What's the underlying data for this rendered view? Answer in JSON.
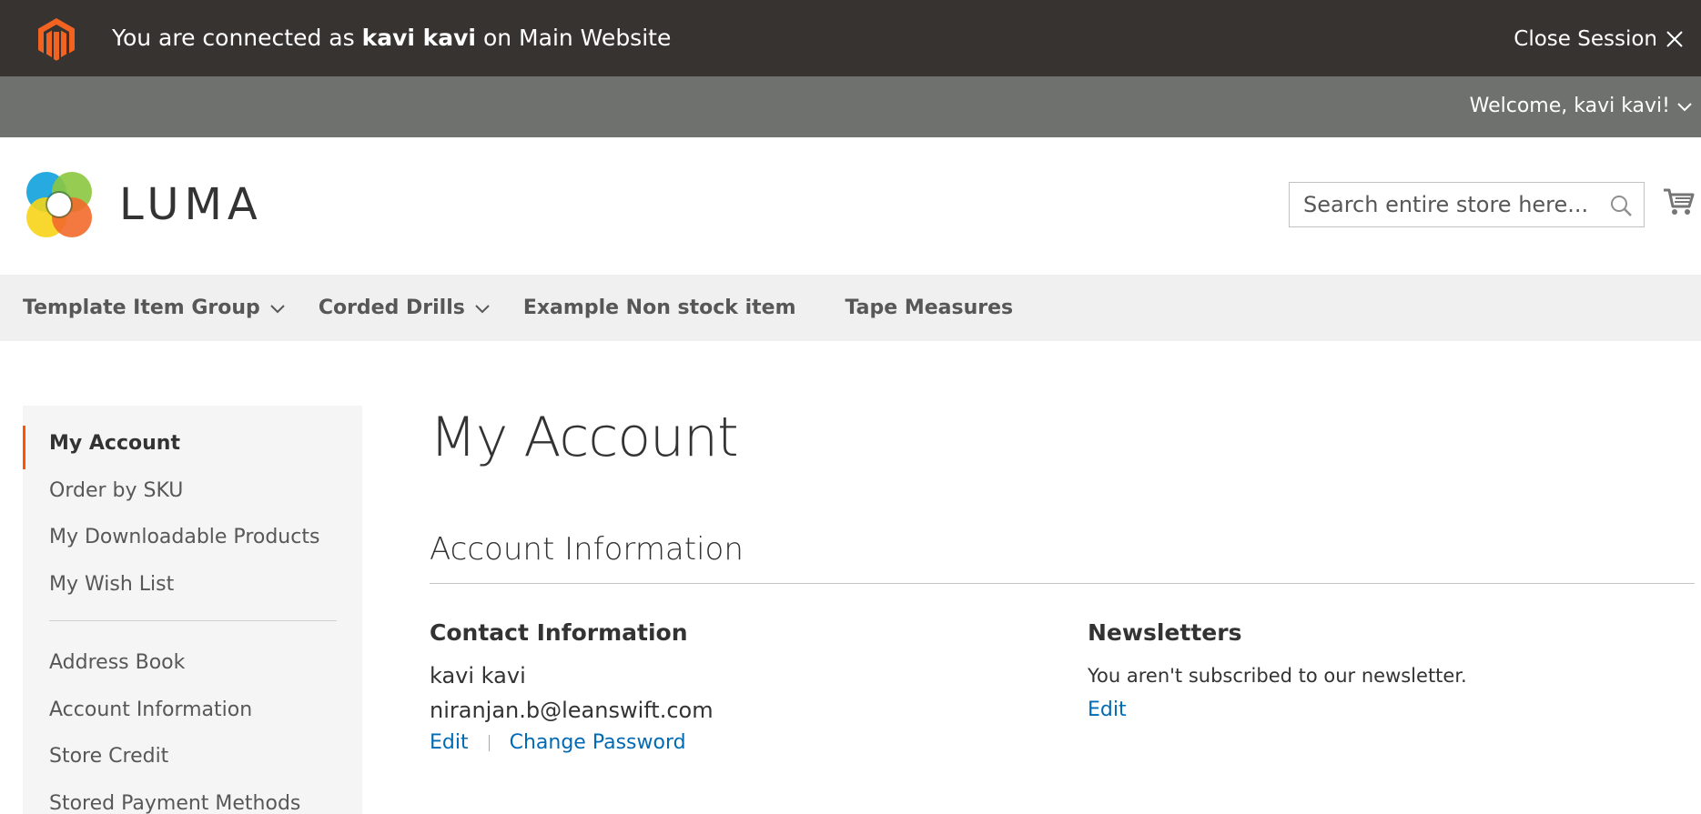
{
  "session_bar": {
    "prefix": "You are connected as",
    "user": "kavi kavi",
    "suffix": "on Main Website",
    "close_label": "Close Session"
  },
  "welcome_bar": {
    "welcome_text": "Welcome, kavi kavi!"
  },
  "header": {
    "logo_text": "LUMA",
    "search_placeholder": "Search entire store here...",
    "search_value": ""
  },
  "nav": {
    "items": [
      {
        "label": "Template Item Group",
        "has_submenu": true
      },
      {
        "label": "Corded Drills",
        "has_submenu": true
      },
      {
        "label": "Example Non stock item",
        "has_submenu": false
      },
      {
        "label": "Tape Measures",
        "has_submenu": false
      }
    ]
  },
  "sidebar": {
    "group1": [
      {
        "label": "My Account",
        "active": true
      },
      {
        "label": "Order by SKU",
        "active": false
      },
      {
        "label": "My Downloadable Products",
        "active": false
      },
      {
        "label": "My Wish List",
        "active": false
      }
    ],
    "group2": [
      {
        "label": "Address Book",
        "active": false
      },
      {
        "label": "Account Information",
        "active": false
      },
      {
        "label": "Store Credit",
        "active": false
      },
      {
        "label": "Stored Payment Methods",
        "active": false
      }
    ]
  },
  "main": {
    "page_title": "My Account",
    "section_title": "Account Information",
    "contact": {
      "title": "Contact Information",
      "name": "kavi kavi",
      "email": "niranjan.b@leanswift.com",
      "edit_label": "Edit",
      "change_password_label": "Change Password"
    },
    "newsletters": {
      "title": "Newsletters",
      "text": "You aren't subscribed to our newsletter.",
      "edit_label": "Edit"
    }
  },
  "colors": {
    "session_bar_bg": "#373330",
    "welcome_bar_bg": "#6e716e",
    "nav_bg": "#f0f0f0",
    "sidebar_bg": "#f5f5f5",
    "active_accent": "#ff5501",
    "link": "#006bb4",
    "magento_orange": "#f26322"
  }
}
